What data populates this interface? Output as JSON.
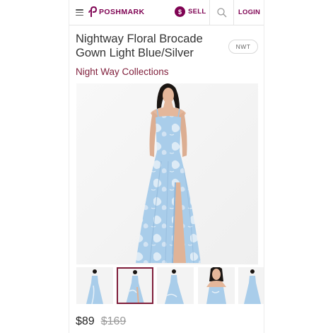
{
  "header": {
    "brand_name": "POSHMARK",
    "sell_badge": "$",
    "sell_label": "SELL",
    "login_label": "LOGIN",
    "brand_color": "#7f0353"
  },
  "listing": {
    "title": "Nightway Floral Brocade Gown Light Blue/Silver",
    "condition_badge": "NWT",
    "brand": "Night Way Collections",
    "price": "$89",
    "original_price": "$169",
    "selected_thumbnail": 2,
    "thumbnail_count": 5
  },
  "icons": {
    "menu": "menu-icon",
    "logo": "poshmark-logo-icon",
    "search": "search-icon"
  },
  "colors": {
    "dress": "#a9cdea",
    "dress_pattern": "#e6f0f8",
    "accent": "#7f1d3a"
  }
}
